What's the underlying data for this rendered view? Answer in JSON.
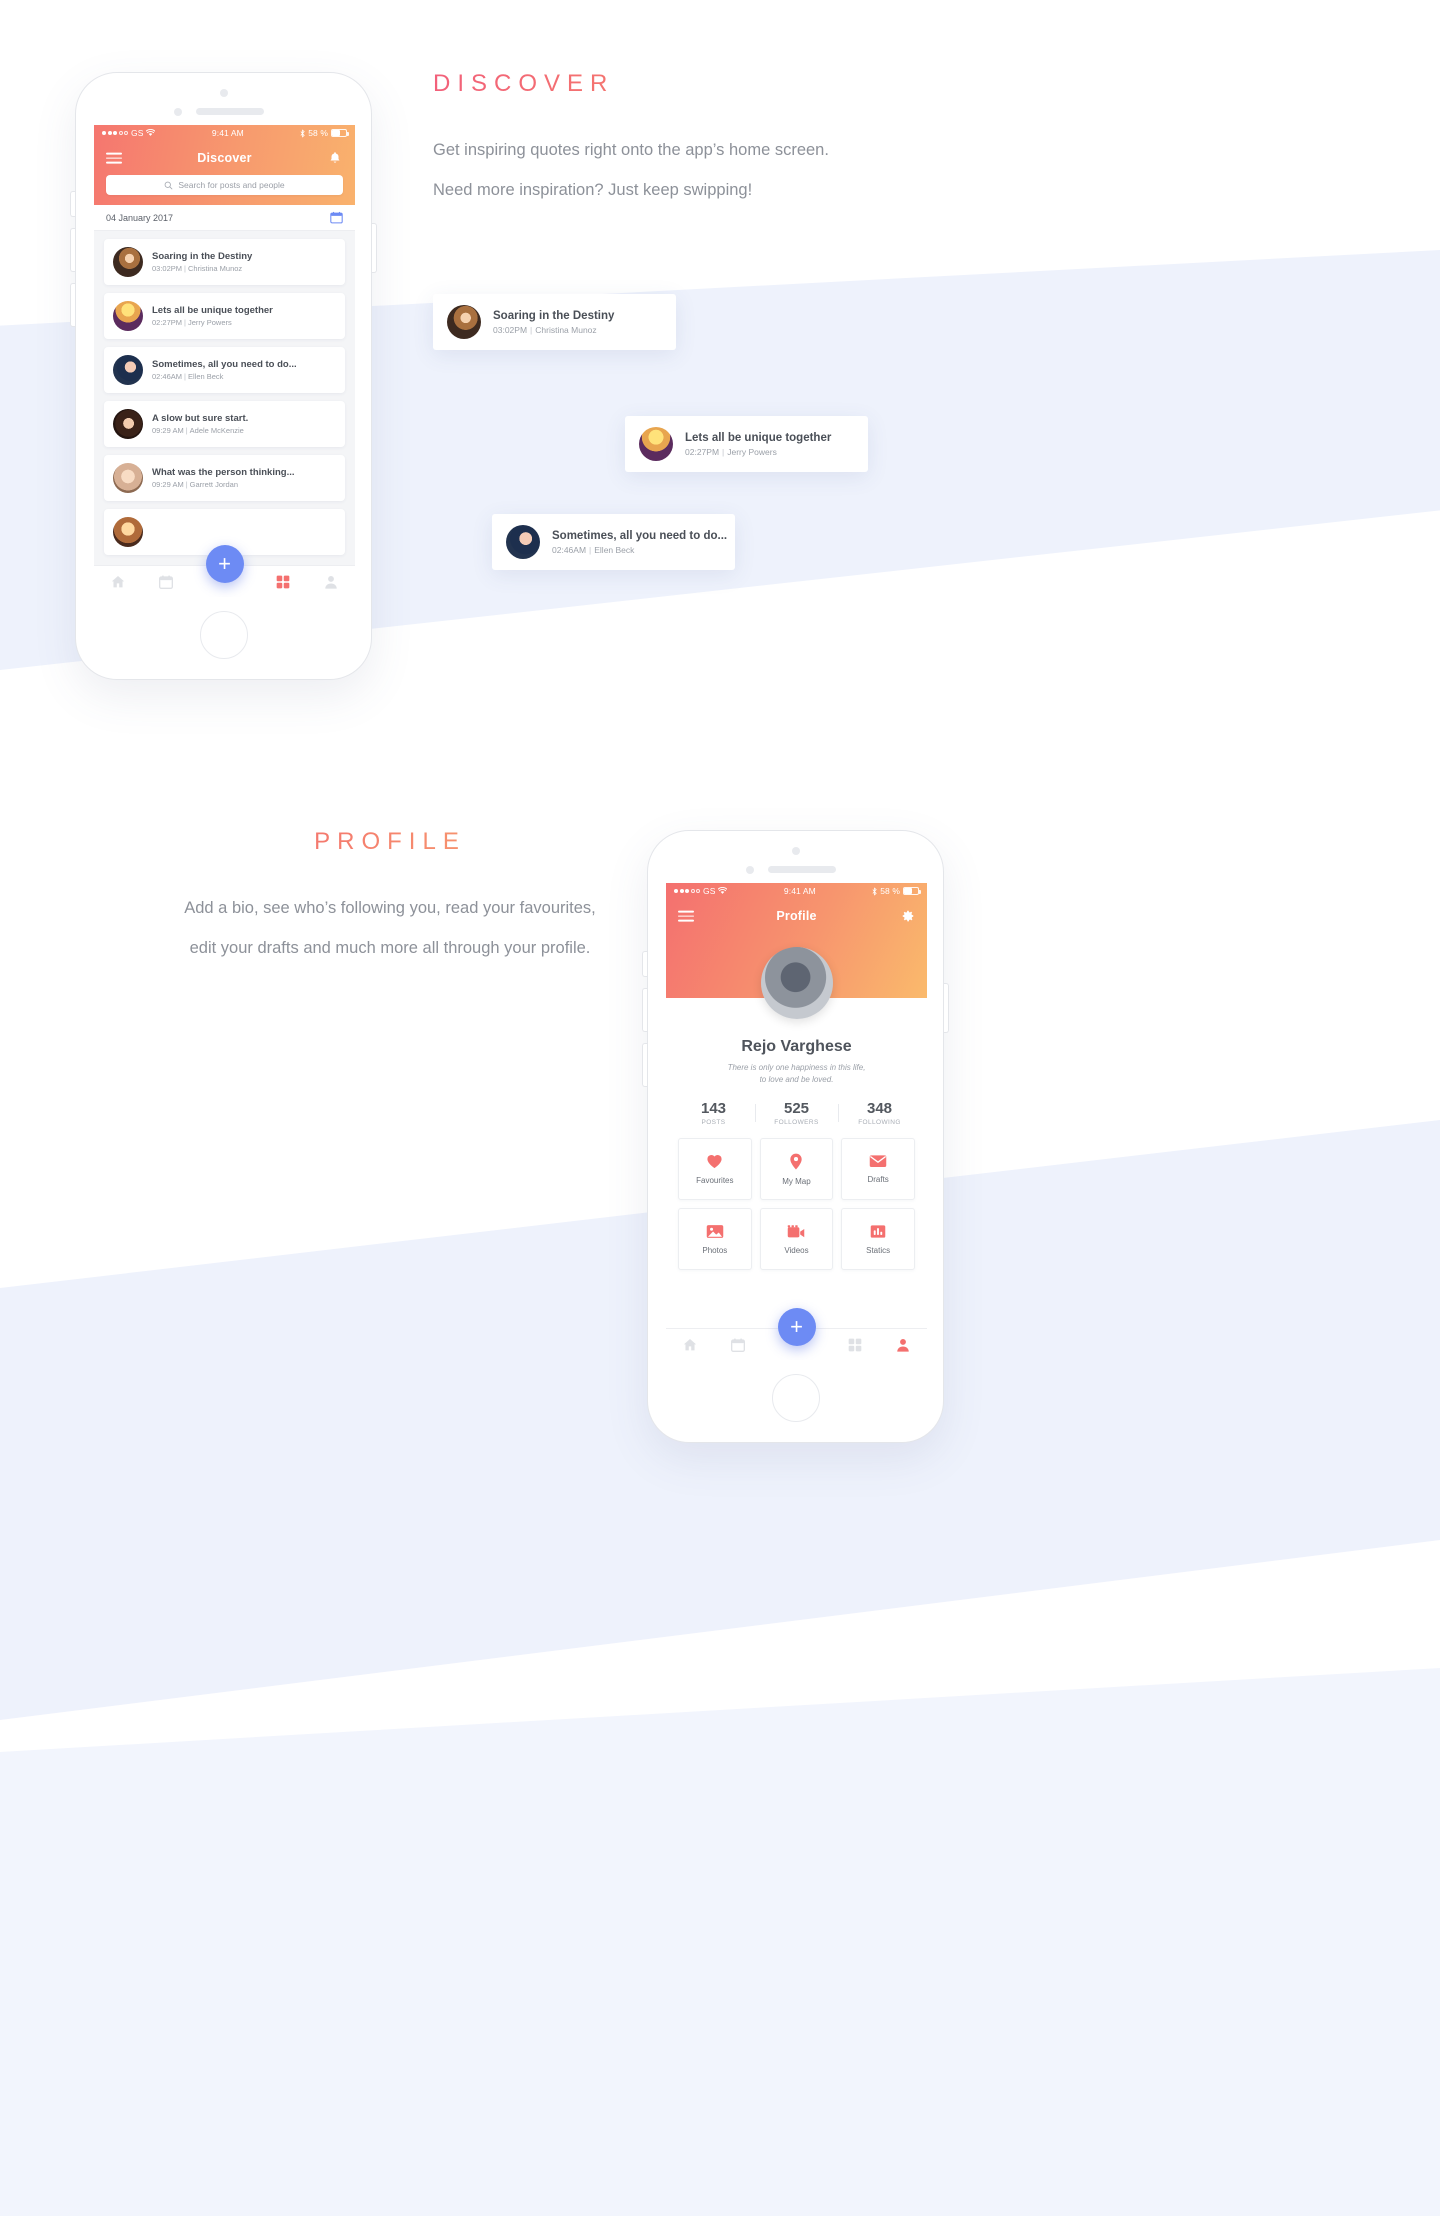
{
  "discover": {
    "section_title": "DISCOVER",
    "paragraph_line1": "Get inspiring quotes right onto the app’s home screen.",
    "paragraph_line2": "Need more inspiration? Just keep swipping!",
    "status_bar": {
      "carrier": "GS",
      "time": "9:41 AM",
      "battery": "58 %"
    },
    "nav_title": "Discover",
    "search_placeholder": "Search for posts and people",
    "date_label": "04 January 2017",
    "posts": [
      {
        "title": "Soaring in the Destiny",
        "time": "03:02PM",
        "author": "Christina Munoz"
      },
      {
        "title": "Lets all be unique together",
        "time": "02:27PM",
        "author": "Jerry Powers"
      },
      {
        "title": "Sometimes, all you need to do...",
        "time": "02:46AM",
        "author": "Ellen Beck"
      },
      {
        "title": "A slow but sure start.",
        "time": "09:29 AM",
        "author": "Adele McKenzie"
      },
      {
        "title": "What was the person thinking...",
        "time": "09:29 AM",
        "author": "Garrett Jordan"
      }
    ],
    "fab_label": "+",
    "tabs": [
      "home-icon",
      "calendar-icon",
      "add-icon",
      "grid-icon",
      "person-icon"
    ]
  },
  "floating_cards": [
    {
      "title": "Soaring in the Destiny",
      "time": "03:02PM",
      "author": "Christina Munoz"
    },
    {
      "title": "Lets all be unique together",
      "time": "02:27PM",
      "author": "Jerry Powers"
    },
    {
      "title": "Sometimes, all you need to do...",
      "time": "02:46AM",
      "author": "Ellen Beck"
    }
  ],
  "profile": {
    "section_title": "PROFILE",
    "paragraph_line1": "Add a bio, see who’s following you, read your favourites,",
    "paragraph_line2": "edit your drafts and much more all through your profile.",
    "status_bar": {
      "carrier": "GS",
      "time": "9:41 AM",
      "battery": "58 %"
    },
    "nav_title": "Profile",
    "name": "Rejo Varghese",
    "bio_line1": "There is only one happiness in this life,",
    "bio_line2": "to love and be loved.",
    "stats": [
      {
        "value": "143",
        "label": "POSTS"
      },
      {
        "value": "525",
        "label": "FOLLOWERS"
      },
      {
        "value": "348",
        "label": "FOLLOWING"
      }
    ],
    "tiles": [
      {
        "label": "Favourites",
        "icon": "heart-icon"
      },
      {
        "label": "My Map",
        "icon": "map-pin-icon"
      },
      {
        "label": "Drafts",
        "icon": "envelope-icon"
      },
      {
        "label": "Photos",
        "icon": "photo-icon"
      },
      {
        "label": "Videos",
        "icon": "video-icon"
      },
      {
        "label": "Statics",
        "icon": "bar-chart-icon"
      }
    ],
    "fab_label": "+"
  },
  "colors": {
    "gradient_start": "#f4706f",
    "gradient_end": "#fabb6c",
    "accent_blue": "#6d8bf4",
    "band": "#eef2fc",
    "text_dark": "#4a4f57",
    "text_muted": "#9ba0a8"
  }
}
